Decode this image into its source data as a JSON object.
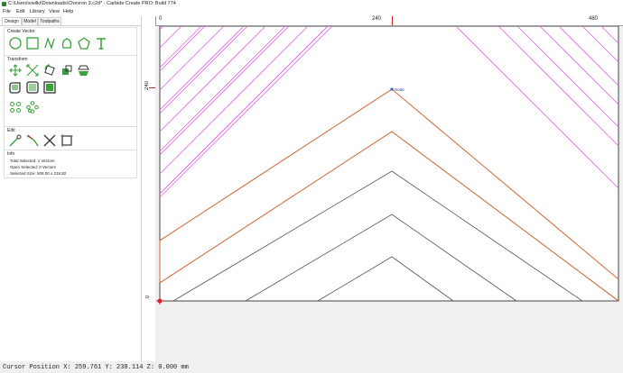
{
  "window": {
    "title": "C:\\Users\\vwilki\\Downloads\\Chevron 3.c2d* - Carbide Create PRO: Build 774"
  },
  "menu": [
    "File",
    "Edit",
    "Library",
    "View",
    "Help"
  ],
  "tabs": [
    {
      "label": "Design",
      "active": true
    },
    {
      "label": "Model",
      "active": false
    },
    {
      "label": "Toolpaths",
      "active": false
    }
  ],
  "create_vector": {
    "title": "Create Vector",
    "tools": [
      "circle-icon",
      "rectangle-icon",
      "curve-icon",
      "polygon-icon",
      "pentagon-icon",
      "text-icon"
    ]
  },
  "transform": {
    "title": "Transform",
    "tools": [
      "move-icon",
      "scale-icon",
      "rotate-icon",
      "mirror-icon",
      "offset-icon",
      "fillet-icon",
      "boolean-icon",
      "align-icon",
      "node-grid-icon",
      "node-pattern-icon"
    ]
  },
  "edit": {
    "title": "Edit",
    "tools": [
      "node-edit-icon",
      "trim-icon",
      "cut-icon",
      "bounding-icon"
    ]
  },
  "info": {
    "title": "Info",
    "total_selected": "Total Selected:  1 Vectors",
    "open_selected": "Open Selected:   0 Vectors",
    "selected_size": "Selected Size:   508.00 x 218.82"
  },
  "ruler": {
    "top_labels": [
      "0",
      "240",
      "480"
    ],
    "left_labels": [
      "240",
      "0"
    ]
  },
  "canvas": {
    "node_label": "Node",
    "colors": {
      "magenta": "#e060e0",
      "orange": "#d07040",
      "gray": "#555555",
      "selection": "#ff0000"
    }
  },
  "status": {
    "text": "Cursor Position X: 259.761 Y: 238.114 Z: 0.000 mm"
  }
}
